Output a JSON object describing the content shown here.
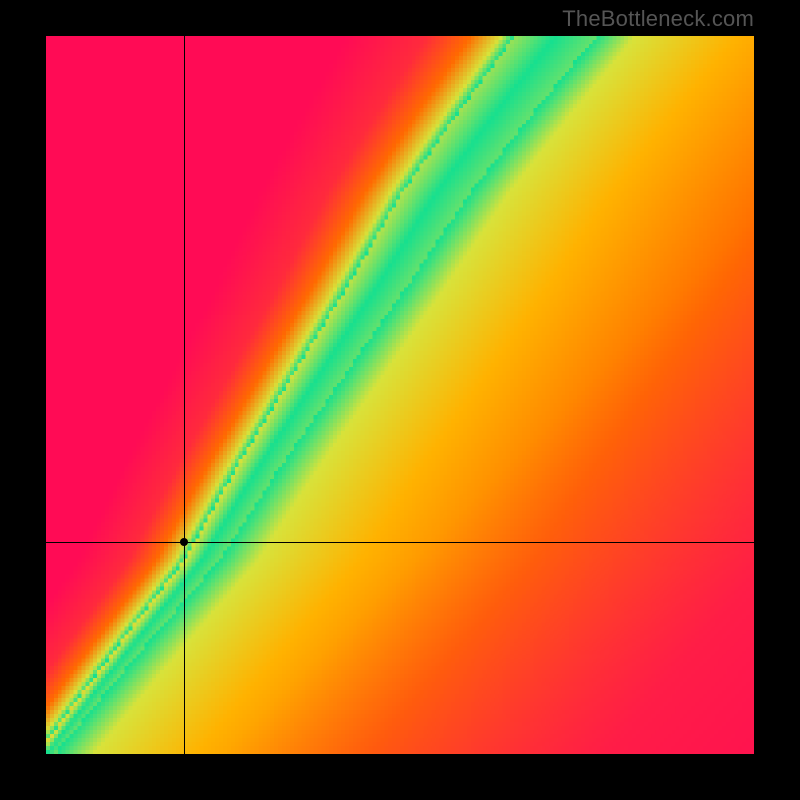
{
  "watermark": "TheBottleneck.com",
  "chart_data": {
    "type": "heatmap",
    "title": "",
    "xlabel": "",
    "ylabel": "",
    "xlim": [
      0,
      1
    ],
    "ylim": [
      0,
      1
    ],
    "optimal_ridge": {
      "description": "Green-highlighted optimal band (y as function of x, normalized 0–1). Points between are interpolated; band half-width in x is ~0.035 near the ridge.",
      "points": [
        {
          "x": 0.0,
          "y": 0.0
        },
        {
          "x": 0.12,
          "y": 0.15
        },
        {
          "x": 0.22,
          "y": 0.27
        },
        {
          "x": 0.3,
          "y": 0.4
        },
        {
          "x": 0.38,
          "y": 0.52
        },
        {
          "x": 0.46,
          "y": 0.64
        },
        {
          "x": 0.55,
          "y": 0.78
        },
        {
          "x": 0.64,
          "y": 0.9
        },
        {
          "x": 0.72,
          "y": 1.0
        }
      ],
      "band_halfwidth_x": 0.035
    },
    "marker": {
      "x": 0.195,
      "y": 0.295
    },
    "palette": {
      "ridge": "#16e08f",
      "near": "#d8e23a",
      "warm": "#ffb200",
      "hot": "#ff6a00",
      "hotter": "#ff2a3c",
      "max": "#ff0b55"
    },
    "grid_resolution": 180
  }
}
